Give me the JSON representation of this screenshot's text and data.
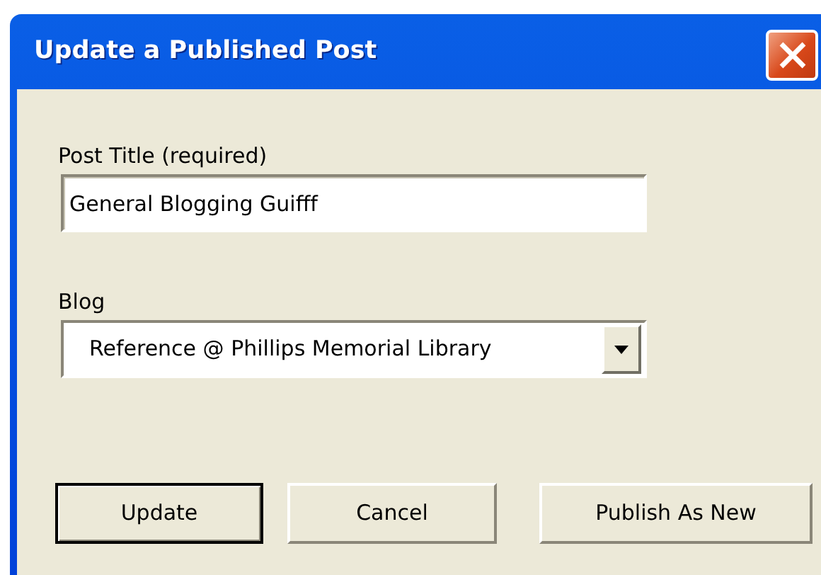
{
  "window": {
    "title": "Update a Published Post"
  },
  "fields": [
    {
      "kind": "text",
      "label": "Post Title (required)",
      "value": "General Blogging Guifff"
    },
    {
      "kind": "dropdown",
      "label": "Blog",
      "value": "Reference @ Phillips Memorial Library"
    }
  ],
  "buttons": [
    {
      "label": "Update",
      "default": true
    },
    {
      "label": "Cancel",
      "default": false
    },
    {
      "label": "Publish As New",
      "default": false
    }
  ]
}
